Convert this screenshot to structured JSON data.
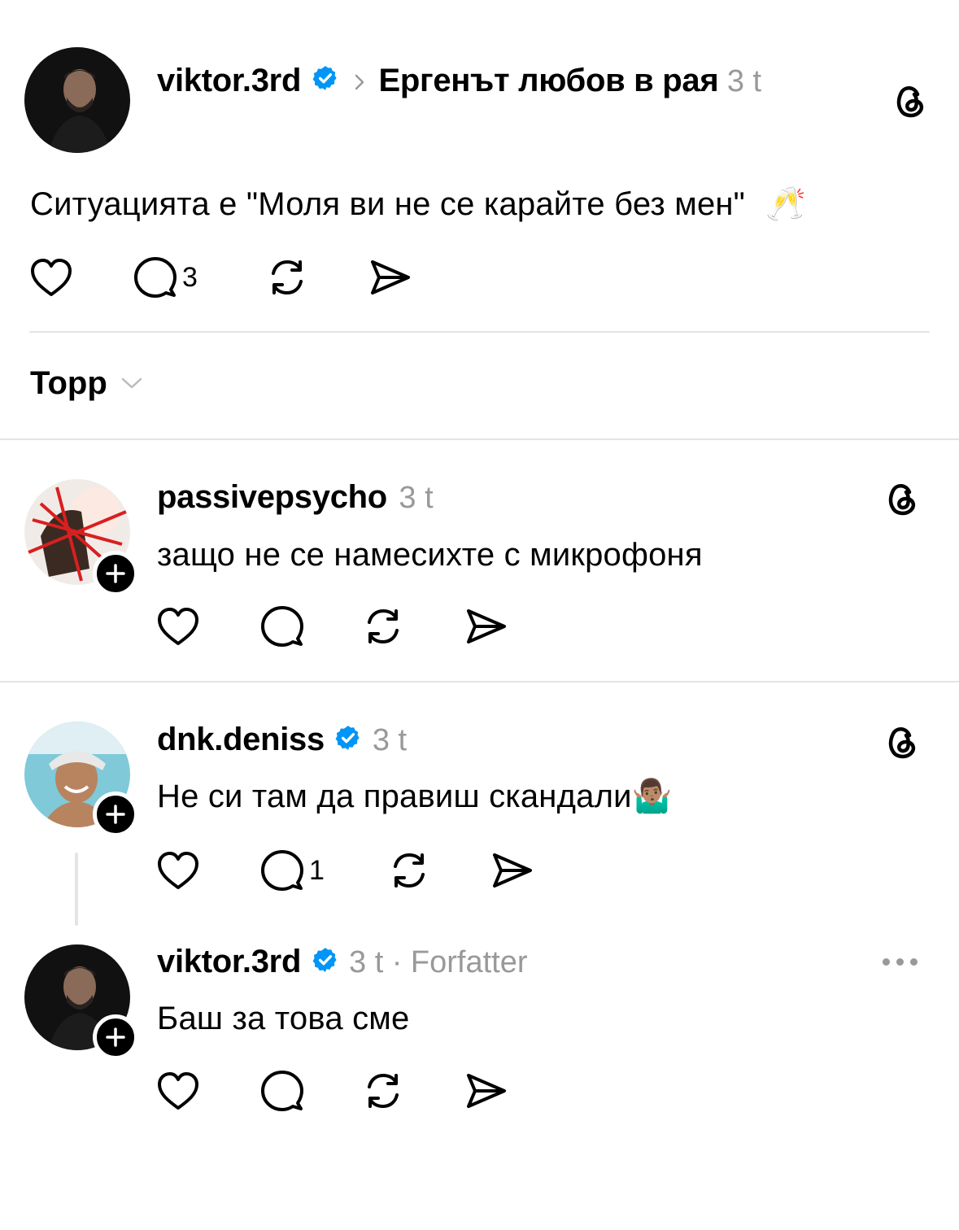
{
  "original_post": {
    "username": "viktor.3rd",
    "verified": true,
    "topic": "Ергенът любов в рая",
    "time": "3 t",
    "text": "Ситуацията е \"Моля ви не се карайте без мен\"",
    "emoji": "🥂",
    "replies_count": "3"
  },
  "sort": {
    "label": "Topp"
  },
  "replies": [
    {
      "username": "passivepsycho",
      "verified": false,
      "time": "3 t",
      "text": "защо не се намесихте с микрофоня",
      "replies_count": ""
    },
    {
      "username": "dnk.deniss",
      "verified": true,
      "time": "3 t",
      "text": "Не си там да правиш скандали",
      "emoji": "🤷🏽‍♂️",
      "replies_count": "1"
    },
    {
      "username": "viktor.3rd",
      "verified": true,
      "time": "3 t",
      "author_label": "· Forfatter",
      "text": "Баш за това сме",
      "replies_count": ""
    }
  ],
  "colors": {
    "verified": "#0095f6",
    "muted": "#999999",
    "divider": "#e4e4e4"
  },
  "icons": [
    "heart-icon",
    "comment-icon",
    "repost-icon",
    "share-icon",
    "threads-logo-icon",
    "chevron-right-icon",
    "chevron-down-icon",
    "more-icon",
    "plus-icon",
    "verified-icon"
  ]
}
